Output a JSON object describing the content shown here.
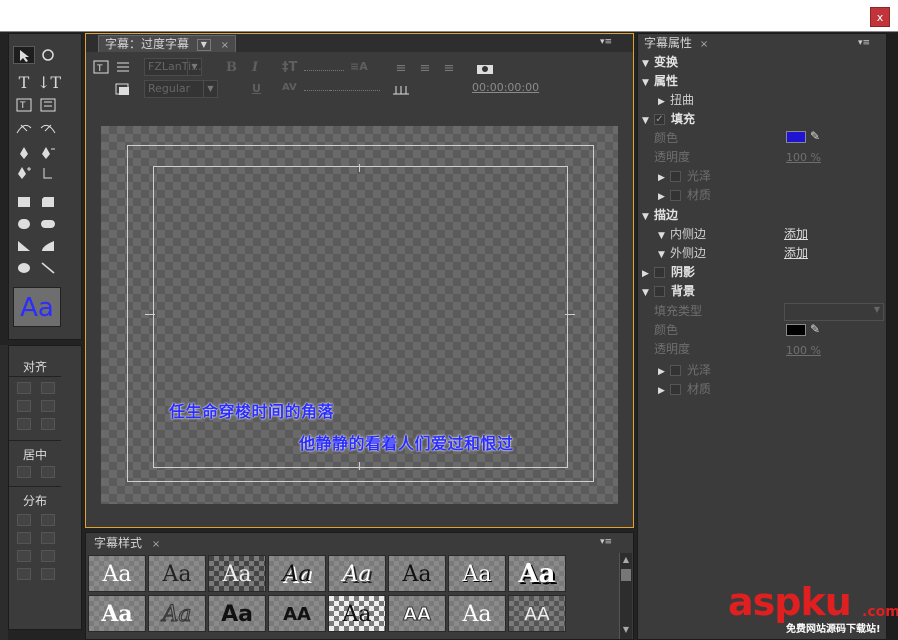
{
  "window": {
    "close_symbol": "x"
  },
  "tools": {
    "items": [
      "selection",
      "rotation",
      "type",
      "vertical-type",
      "area-type",
      "vertical-area-type",
      "path-type",
      "vertical-path-type",
      "pen",
      "delete-anchor",
      "add-anchor",
      "convert-anchor",
      "rectangle",
      "clipped-corner-rect",
      "rounded-rect",
      "rounded-corner-rect",
      "wedge",
      "arc",
      "ellipse",
      "line"
    ],
    "style_preview": "Aa",
    "style_preview_color": "#2a2dff"
  },
  "align": {
    "align_label": "对齐",
    "center_label": "居中",
    "distribute_label": "分布"
  },
  "designer": {
    "tab_label": "字幕：过度字幕",
    "tab_close": "×",
    "menu_glyph": "▾≡",
    "font_family": "FZLanTi...",
    "font_style": "Regular",
    "bold": "B",
    "italic": "I",
    "underline": "U",
    "timecode": "00:00:00:00",
    "subtitle_line1": "任生命穿梭时间的角落",
    "subtitle_line2": "他静静的看着人们爱过和恨过",
    "subtitle_color": "#2b2dff"
  },
  "styles_panel": {
    "tab_label": "字幕样式",
    "tab_close": "×",
    "tiles": [
      "Aa",
      "Aa",
      "Aa",
      "Aa",
      "Aa",
      "Aa",
      "Aa",
      "Aa",
      "Aa",
      "Aa",
      "Aa",
      "AA",
      "Aa",
      "AA",
      "Aa",
      "AA"
    ]
  },
  "props": {
    "tab_label": "字幕属性",
    "tab_close": "×",
    "transform": "变换",
    "properties": "属性",
    "distort": "扭曲",
    "fill": "填充",
    "color_label": "颜色",
    "opacity_label": "透明度",
    "fill_color": "#1e14d2",
    "fill_opacity": "100 %",
    "sheen": "光泽",
    "texture": "材质",
    "strokes": "描边",
    "inner_stroke": "内侧边",
    "outer_stroke": "外侧边",
    "add": "添加",
    "shadow": "阴影",
    "background": "背景",
    "fill_type": "填充类型",
    "bg_color_label": "颜色",
    "bg_color": "#000000",
    "bg_opacity_label": "透明度",
    "bg_opacity": "100 %",
    "bg_sheen": "光泽",
    "bg_texture": "材质"
  },
  "watermark": {
    "main": "aspku",
    "suffix": ".com",
    "tagline": "免费网站源码下载站!"
  }
}
